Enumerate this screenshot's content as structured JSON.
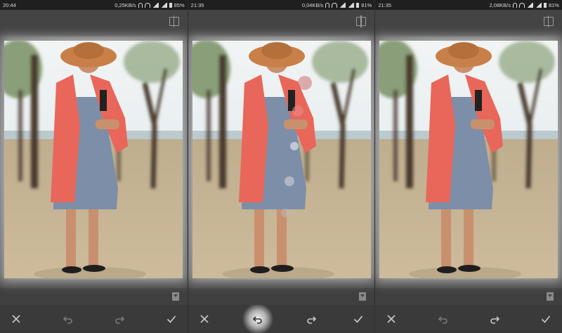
{
  "panels": [
    {
      "status": {
        "time": "20:44",
        "speed": "0,25KB/s",
        "battery": "85%"
      },
      "toolbar": {
        "undo_enabled": false,
        "redo_enabled": false,
        "undo_active": false
      },
      "photo_variant": "original"
    },
    {
      "status": {
        "time": "21:35",
        "speed": "0,04KB/s",
        "battery": "81%"
      },
      "toolbar": {
        "undo_enabled": true,
        "redo_enabled": true,
        "undo_active": true
      },
      "photo_variant": "edited-artifacts"
    },
    {
      "status": {
        "time": "21:35",
        "speed": "2,08KB/s",
        "battery": "81%"
      },
      "toolbar": {
        "undo_enabled": false,
        "redo_enabled": true,
        "undo_active": false
      },
      "photo_variant": "original"
    }
  ],
  "icons": {
    "compare": "compare-icon",
    "bookmark": "bookmark-icon",
    "cancel": "close-icon",
    "undo": "undo-icon",
    "redo": "redo-icon",
    "apply": "check-icon"
  },
  "colors": {
    "sky": "#e8eef0",
    "sand": "#cdbb9c",
    "coat": "#e8675a",
    "dress": "#7d8ea8",
    "hat": "#c88048",
    "tree": "#4a3a2e",
    "foliage": "#6f8a5a"
  }
}
